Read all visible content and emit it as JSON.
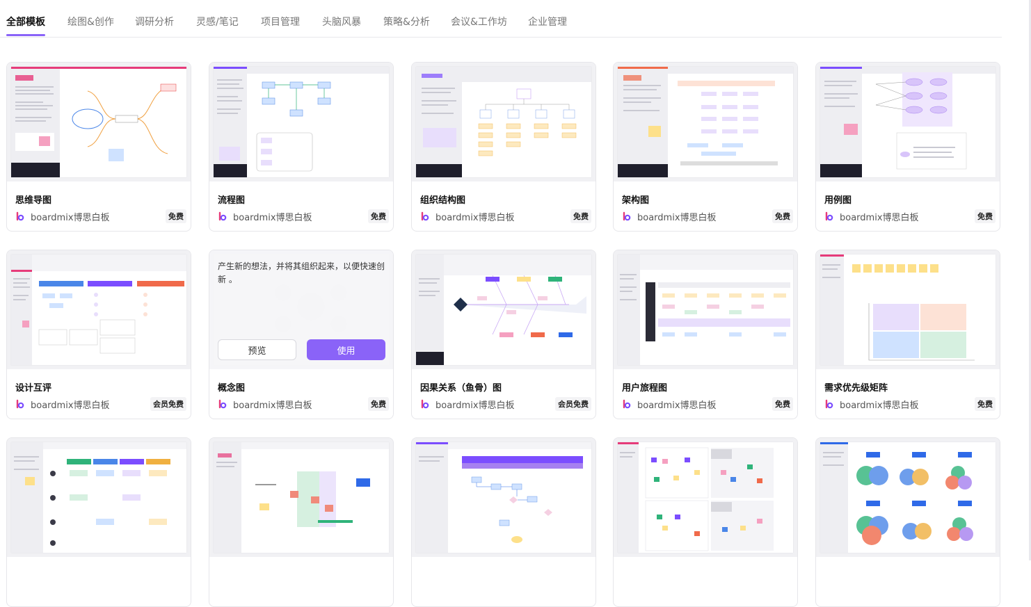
{
  "tabs": [
    {
      "label": "全部模板",
      "active": true
    },
    {
      "label": "绘图&创作"
    },
    {
      "label": "调研分析"
    },
    {
      "label": "灵感/笔记"
    },
    {
      "label": "项目管理"
    },
    {
      "label": "头脑风暴"
    },
    {
      "label": "策略&分析"
    },
    {
      "label": "会议&工作坊"
    },
    {
      "label": "企业管理"
    }
  ],
  "cards": [
    {
      "title": "思维导图",
      "author": "boardmix博思白板",
      "badge": "免费",
      "thumbnail": "mindmap"
    },
    {
      "title": "流程图",
      "author": "boardmix博思白板",
      "badge": "免费",
      "thumbnail": "flowchart"
    },
    {
      "title": "组织结构图",
      "author": "boardmix博思白板",
      "badge": "免费",
      "thumbnail": "org-chart"
    },
    {
      "title": "架构图",
      "author": "boardmix博思白板",
      "badge": "免费",
      "thumbnail": "architecture"
    },
    {
      "title": "用例图",
      "author": "boardmix博思白板",
      "badge": "免费",
      "thumbnail": "use-case"
    },
    {
      "title": "设计互评",
      "author": "boardmix博思白板",
      "badge": "会员免费",
      "thumbnail": "design-review"
    },
    {
      "title": "概念图",
      "author": "boardmix博思白板",
      "badge": "免费",
      "thumbnail": "concept-map",
      "hover": true,
      "description": "产生新的想法，并将其组织起来，以便快速创新 。",
      "preview_label": "预览",
      "use_label": "使用"
    },
    {
      "title": "因果关系（鱼骨）图",
      "author": "boardmix博思白板",
      "badge": "会员免费",
      "thumbnail": "fishbone"
    },
    {
      "title": "用户旅程图",
      "author": "boardmix博思白板",
      "badge": "免费",
      "thumbnail": "user-journey"
    },
    {
      "title": "需求优先级矩阵",
      "author": "boardmix博思白板",
      "badge": "免费",
      "thumbnail": "priority-matrix"
    },
    {
      "thumbnail": "persona-table"
    },
    {
      "thumbnail": "gantt"
    },
    {
      "thumbnail": "process-flow"
    },
    {
      "thumbnail": "sticky-board"
    },
    {
      "thumbnail": "venn"
    }
  ],
  "colors": {
    "accent": "#8a63f8",
    "brand_logo": [
      "#e63b7a",
      "#7b4dff"
    ]
  },
  "icons": {
    "author_logo": "boardmix-logo-icon"
  }
}
